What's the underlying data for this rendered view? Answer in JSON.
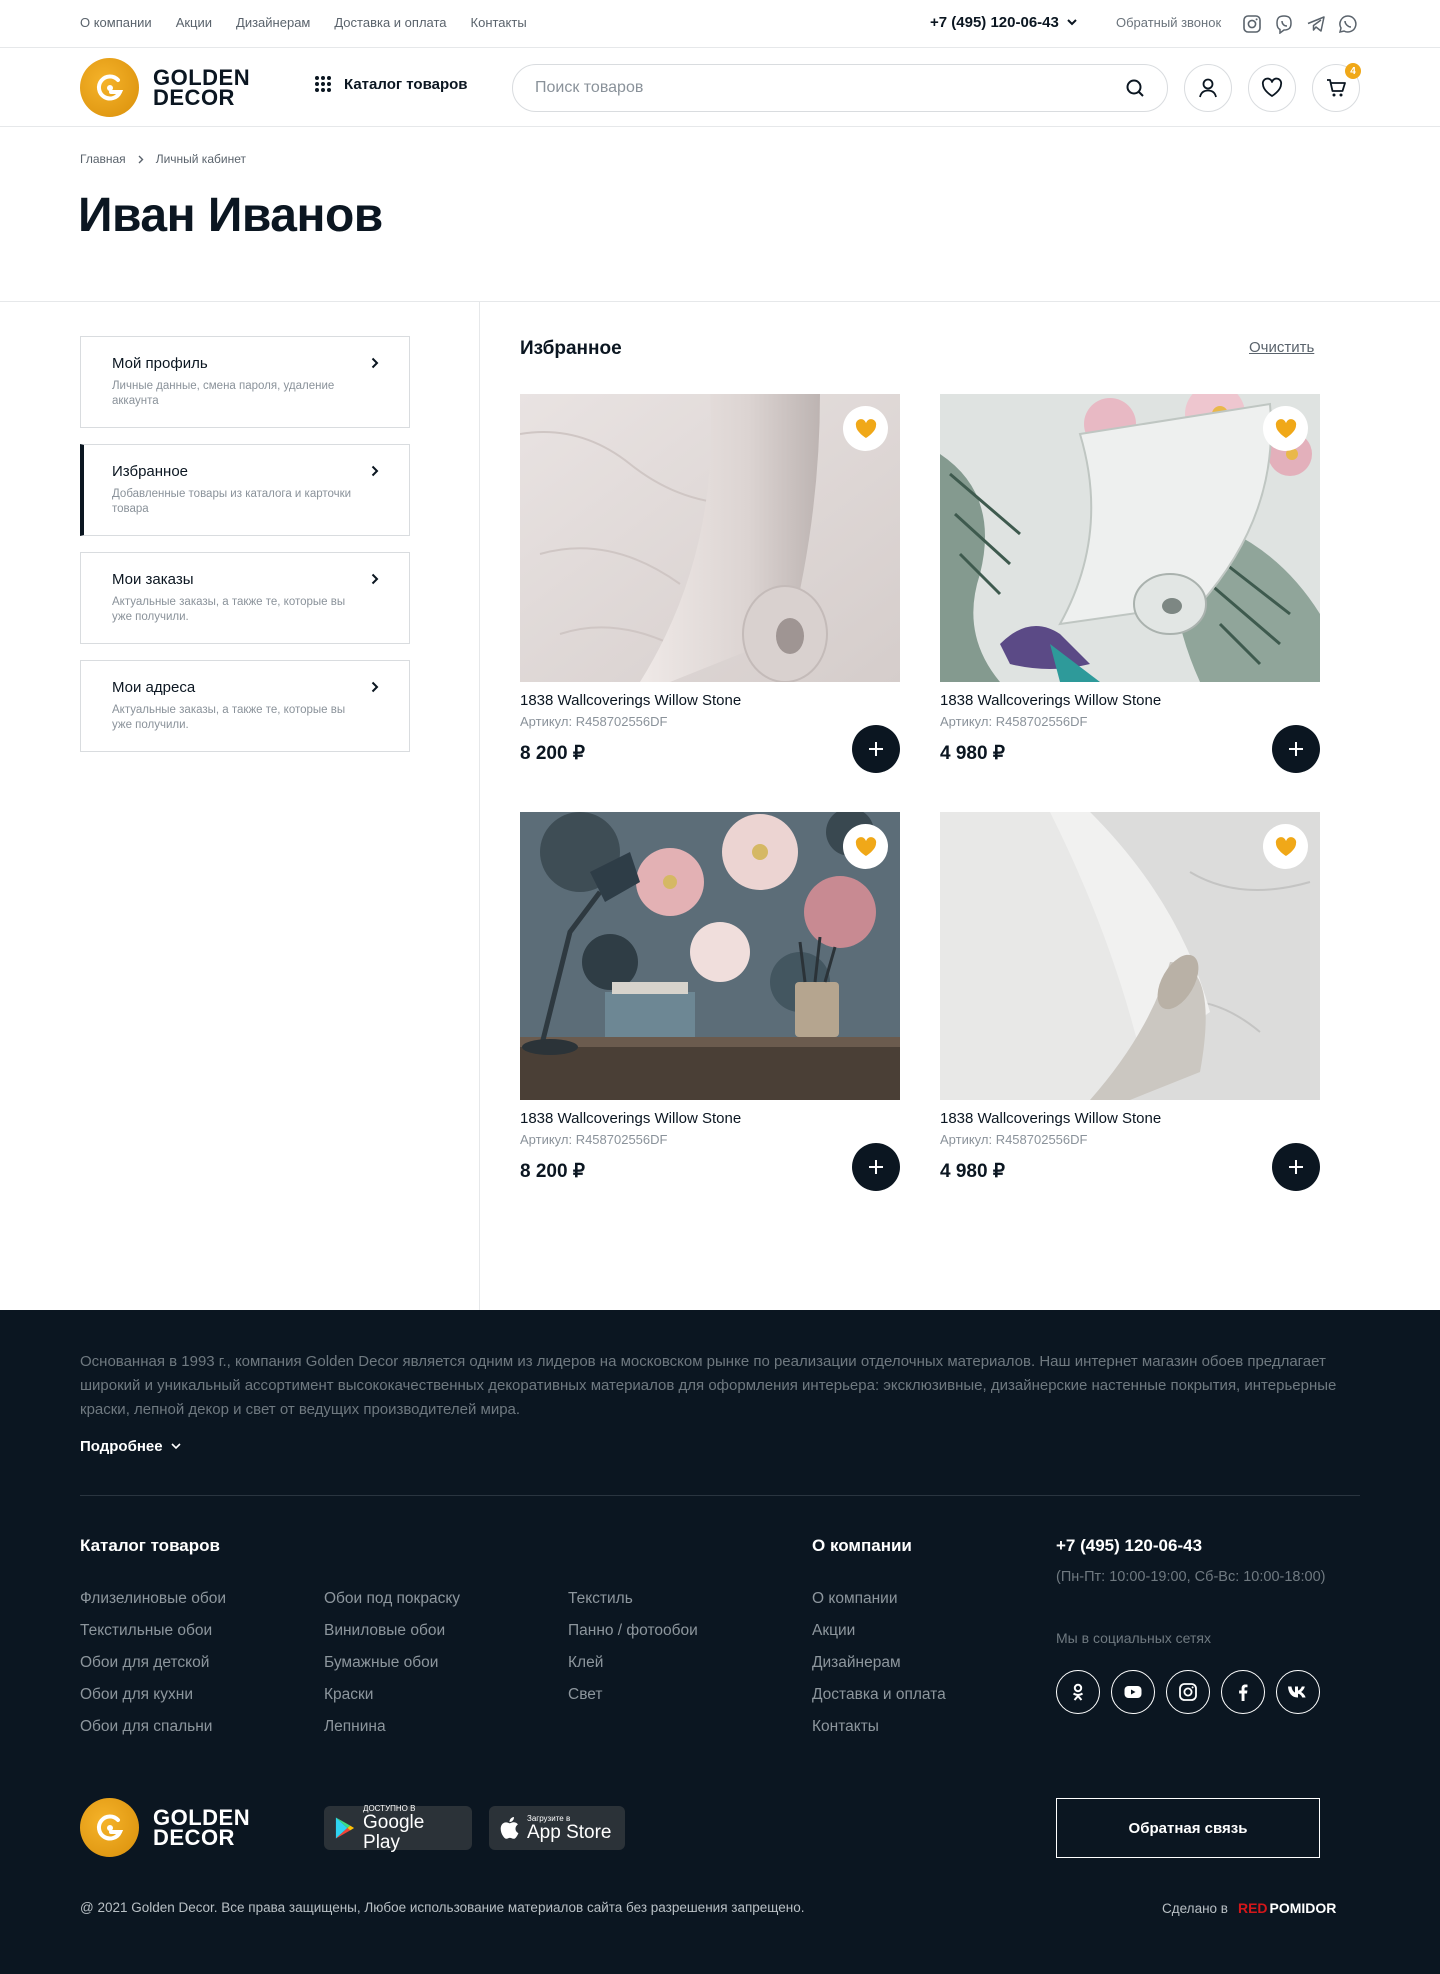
{
  "topbar": {
    "nav": [
      "О компании",
      "Акции",
      "Дизайнерам",
      "Доставка и оплата",
      "Контакты"
    ],
    "phone": "+7 (495) 120-06-43",
    "callback": "Обратный звонок"
  },
  "header": {
    "logo_line1": "GOLDEN",
    "logo_line2": "DECOR",
    "catalog_label": "Каталог товаров",
    "search_placeholder": "Поиск товаров",
    "cart_count": "4"
  },
  "breadcrumb": {
    "home": "Главная",
    "current": "Личный кабинет"
  },
  "page_title": "Иван Иванов",
  "sidebar": {
    "items": [
      {
        "title": "Мой профиль",
        "subtitle": "Личные данные, смена пароля, удаление аккаунта"
      },
      {
        "title": "Избранное",
        "subtitle": "Добавленные товары из каталога и карточки товара"
      },
      {
        "title": "Мои заказы",
        "subtitle": "Актуальные заказы, а также те, которые вы уже получили."
      },
      {
        "title": "Мои адреса",
        "subtitle": "Актуальные заказы, а также те, которые вы уже получили."
      }
    ]
  },
  "favorites": {
    "title": "Избранное",
    "clear_label": "Очистить",
    "products": [
      {
        "name": "1838 Wallcoverings Willow Stone",
        "article": "Артикул: R458702556DF",
        "price": "8 200 ₽"
      },
      {
        "name": "1838 Wallcoverings Willow Stone",
        "article": "Артикул: R458702556DF",
        "price": "4 980 ₽"
      },
      {
        "name": "1838 Wallcoverings Willow Stone",
        "article": "Артикул: R458702556DF",
        "price": "8 200 ₽"
      },
      {
        "name": "1838 Wallcoverings Willow Stone",
        "article": "Артикул: R458702556DF",
        "price": "4 980 ₽"
      }
    ]
  },
  "footer": {
    "about": "Основанная в 1993 г., компания Golden Decor является одним из лидеров на московском рынке по реализации отделочных материалов. Наш интернет магазин обоев предлагает широкий и уникальный ассортимент высококачественных декоративных материалов для оформления интерьера: эксклюзивные, дизайнерские настенные покрытия, интерьерные краски, лепной декор и свет от ведущих производителей мира.",
    "more_label": "Подробнее",
    "catalog_title": "Каталог товаров",
    "catalog_col1": [
      "Флизелиновые обои",
      "Текстильные обои",
      "Обои для детской",
      "Обои для кухни",
      "Обои для спальни"
    ],
    "catalog_col2": [
      "Обои под покраску",
      "Виниловые обои",
      "Бумажные обои",
      "Краски",
      "Лепнина"
    ],
    "catalog_col3": [
      "Текстиль",
      "Панно / фотообои",
      "Клей",
      "Свет"
    ],
    "company_title": "О компании",
    "company_links": [
      "О компании",
      "Акции",
      "Дизайнерам",
      "Доставка и оплата",
      "Контакты"
    ],
    "phone": "+7 (495) 120-06-43",
    "hours": "(Пн-Пт: 10:00-19:00, Сб-Вс: 10:00-18:00)",
    "socials_title": "Мы в социальных сетях",
    "google_small": "ДОСТУПНО В",
    "google_big": "Google Play",
    "apple_small": "Загрузите в",
    "apple_big": "App Store",
    "feedback_label": "Обратная связь",
    "copyright": "@ 2021 Golden Decor. Все права защищены, Любое использование материалов сайта без разрешения запрещено.",
    "made_in": "Сделано в",
    "made_red": "RED",
    "made_white": "POMIDOR"
  },
  "colors": {
    "accent": "#f0a818",
    "dark": "#0b1621"
  }
}
